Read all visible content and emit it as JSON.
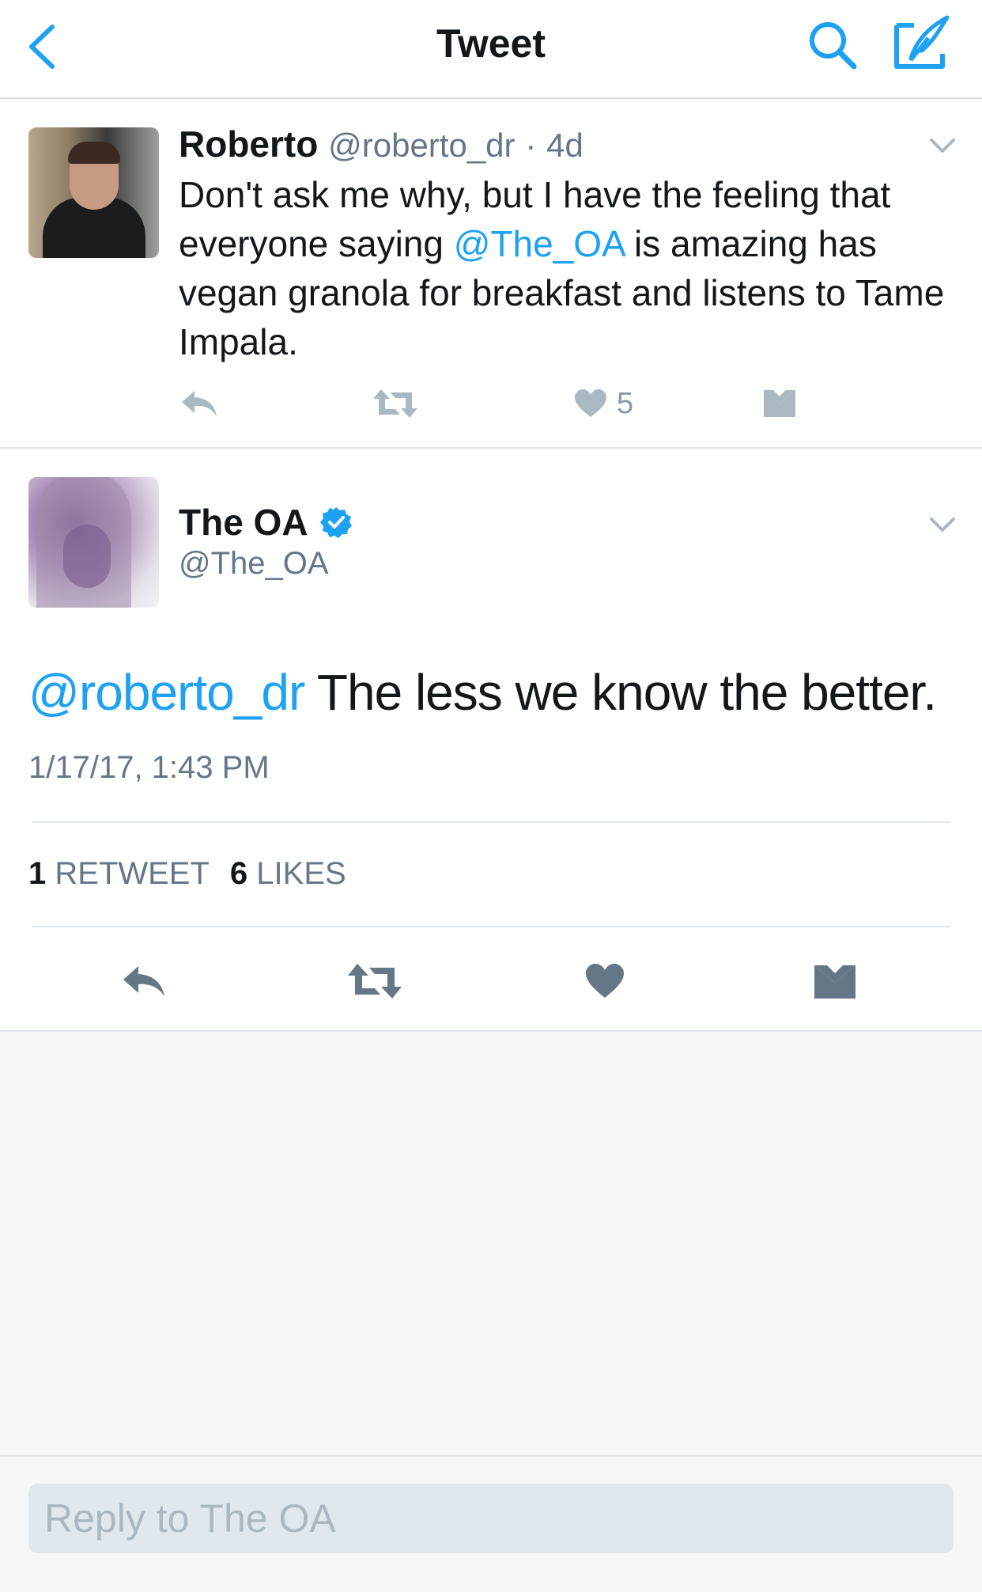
{
  "nav": {
    "title": "Tweet",
    "back_icon": "chevron-left-icon",
    "search_icon": "search-icon",
    "compose_icon": "compose-tweet-icon"
  },
  "colors": {
    "accent": "#1da1f2",
    "text": "#14171a",
    "secondary": "#657786",
    "icon_gray": "#8899a6",
    "background": "#f5f8fa"
  },
  "parent_tweet": {
    "name": "Roberto",
    "handle": "@roberto_dr",
    "dot": "·",
    "time": "4d",
    "text_before": "Don't ask me why, but I have the feeling that everyone saying ",
    "mention": "@The_OA",
    "text_after": " is amazing has vegan granola for breakfast and listens to Tame Impala.",
    "like_count": "5"
  },
  "main_tweet": {
    "name": "The OA",
    "handle": "@The_OA",
    "mention": "@roberto_dr",
    "text": " The less we know the better.",
    "timestamp": "1/17/17, 1:43 PM",
    "retweet_count": "1",
    "retweet_label": "RETWEET",
    "like_count": "6",
    "like_label": "LIKES"
  },
  "reply": {
    "placeholder": "Reply to The OA"
  }
}
